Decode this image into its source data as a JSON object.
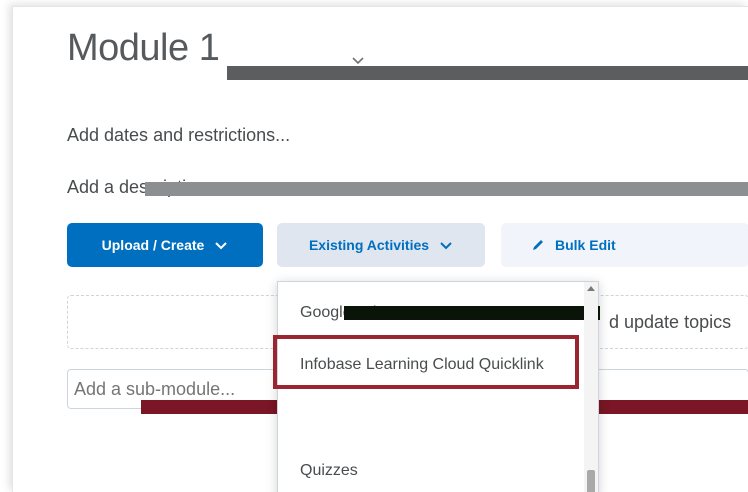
{
  "module": {
    "title": "Module 1"
  },
  "links": {
    "dates": "Add dates and restrictions...",
    "description": "Add a description..."
  },
  "toolbar": {
    "upload_label": "Upload / Create",
    "existing_label": "Existing Activities",
    "bulk_edit_label": "Bulk Edit"
  },
  "drop_zone": {
    "text": "d update topics"
  },
  "submodule": {
    "placeholder": "Add a sub-module..."
  },
  "dropdown": {
    "items": [
      {
        "label": "Google Drive"
      },
      {
        "label": "Infobase Learning Cloud Quicklink"
      },
      {
        "label": "Quizzes"
      }
    ]
  },
  "colors": {
    "primary": "#006fbf",
    "highlight": "#9a2530"
  }
}
